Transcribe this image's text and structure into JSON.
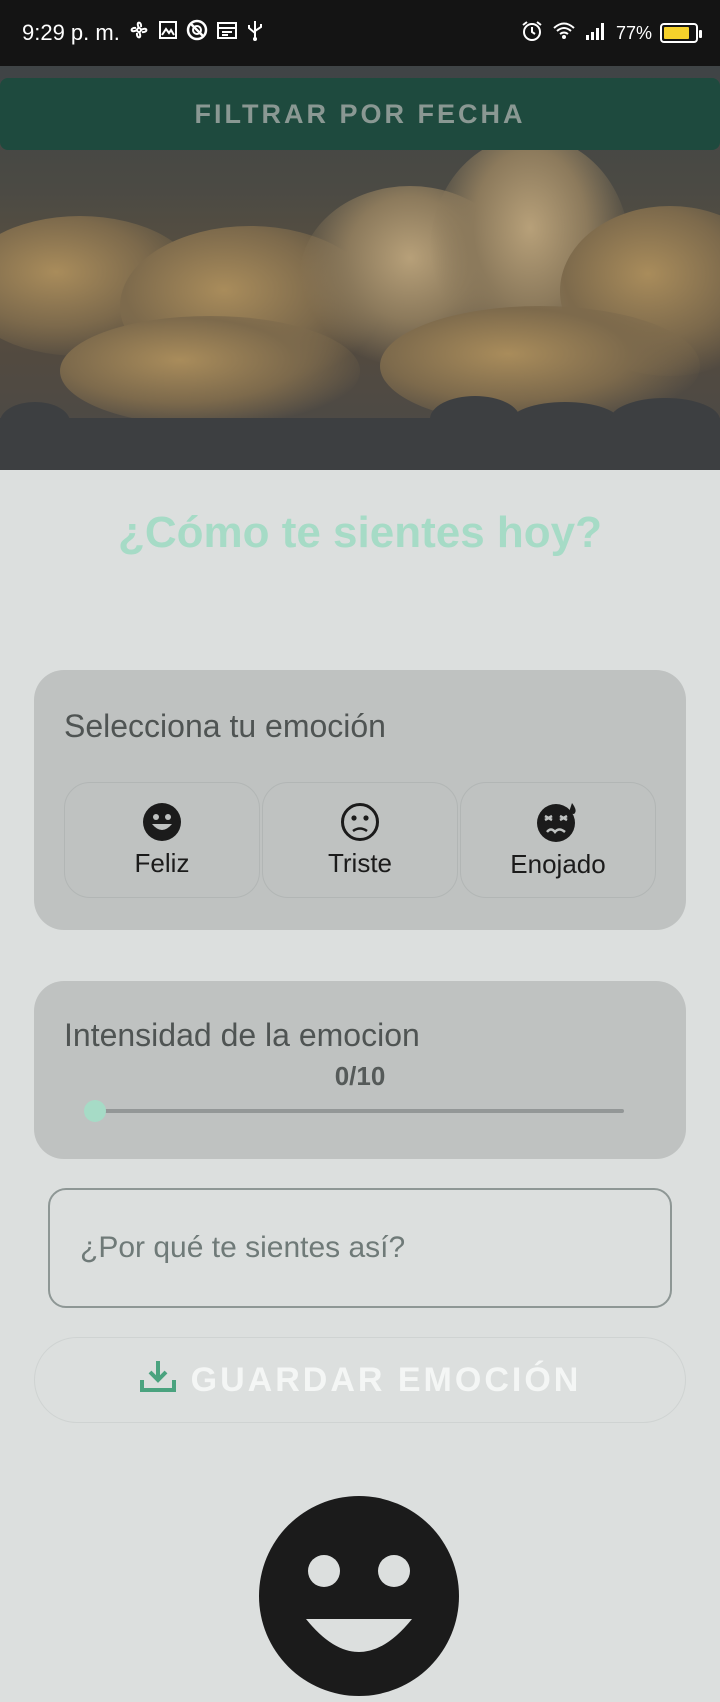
{
  "status_bar": {
    "time": "9:29 p. m.",
    "battery_percent": "77%",
    "battery_level": 0.77,
    "icons_left": [
      "fan-icon",
      "gallery-icon",
      "no-disturb-icon",
      "calendar-icon",
      "usb-icon"
    ],
    "icons_right": [
      "alarm-icon",
      "wifi-icon",
      "signal-icon",
      "battery-charging-icon"
    ]
  },
  "header": {
    "filter_label": "FILTRAR POR FECHA"
  },
  "main": {
    "title": "¿Cómo te sientes hoy?",
    "emotion_card": {
      "heading": "Selecciona tu emoción",
      "options": [
        {
          "label": "Feliz",
          "icon": "happy-face-icon"
        },
        {
          "label": "Triste",
          "icon": "sad-face-icon"
        },
        {
          "label": "Enojado",
          "icon": "angry-face-icon"
        }
      ]
    },
    "intensity_card": {
      "heading": "Intensidad de la emocion",
      "value_text": "0/10",
      "value": 0,
      "max": 10
    },
    "reason_input": {
      "placeholder": "¿Por qué te sientes así?",
      "value": ""
    },
    "save_button": {
      "label": "GUARDAR EMOCIÓN",
      "icon": "download-icon"
    },
    "selected_emotion_icon": "happy-face-icon"
  },
  "colors": {
    "accent": "#a6dbc6",
    "filter_button_bg": "#1e4a3e",
    "icon_green": "#4aa37f"
  }
}
